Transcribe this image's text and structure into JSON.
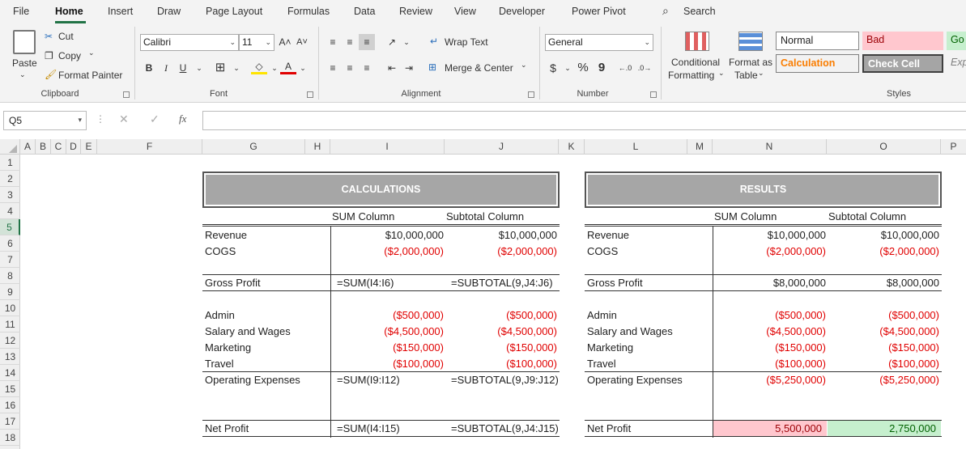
{
  "tabs": [
    "File",
    "Home",
    "Insert",
    "Draw",
    "Page Layout",
    "Formulas",
    "Data",
    "Review",
    "View",
    "Developer",
    "Power Pivot"
  ],
  "search": "Search",
  "clipboard": {
    "paste": "Paste",
    "cut": "Cut",
    "copy": "Copy",
    "format_painter": "Format Painter",
    "label": "Clipboard"
  },
  "font": {
    "name": "Calibri",
    "size": "11",
    "bold": "B",
    "italic": "I",
    "underline": "U",
    "label": "Font"
  },
  "alignment": {
    "wrap": "Wrap Text",
    "merge": "Merge & Center",
    "label": "Alignment"
  },
  "number": {
    "format": "General",
    "currency": "$",
    "percent": "%",
    "comma": "9",
    "label": "Number"
  },
  "styles": {
    "conditional": "Conditional",
    "conditional2": "Formatting",
    "format_as": "Format as",
    "format_as2": "Table",
    "normal": "Normal",
    "bad": "Bad",
    "good": "Go",
    "calculation": "Calculation",
    "check_cell": "Check Cell",
    "explanatory": "Exp",
    "label": "Styles"
  },
  "namebox": "Q5",
  "fx": "fx",
  "columns": [
    "A",
    "B",
    "C",
    "D",
    "E",
    "F",
    "G",
    "H",
    "I",
    "J",
    "K",
    "L",
    "M",
    "N",
    "O",
    "P"
  ],
  "rows": [
    "1",
    "2",
    "3",
    "4",
    "5",
    "6",
    "7",
    "8",
    "9",
    "10",
    "11",
    "12",
    "13",
    "14",
    "15",
    "16",
    "17",
    "18"
  ],
  "calc": {
    "title": "CALCULATIONS",
    "head_sum": "SUM Column",
    "head_sub": "Subtotal Column",
    "revenue": "Revenue",
    "revenue_sum": "$10,000,000",
    "revenue_sub": "$10,000,000",
    "cogs": "COGS",
    "cogs_sum": "($2,000,000)",
    "cogs_sub": "($2,000,000)",
    "gross": "Gross Profit",
    "gross_sum": "=SUM(I4:I6)",
    "gross_sub": "=SUBTOTAL(9,J4:J6)",
    "admin": "Admin",
    "admin_sum": "($500,000)",
    "admin_sub": "($500,000)",
    "salary": "Salary and Wages",
    "salary_sum": "($4,500,000)",
    "salary_sub": "($4,500,000)",
    "marketing": "Marketing",
    "marketing_sum": "($150,000)",
    "marketing_sub": "($150,000)",
    "travel": "Travel",
    "travel_sum": "($100,000)",
    "travel_sub": "($100,000)",
    "opex": "Operating Expenses",
    "opex_sum": "=SUM(I9:I12)",
    "opex_sub": "=SUBTOTAL(9,J9:J12)",
    "net": "Net Profit",
    "net_sum": "=SUM(I4:I15)",
    "net_sub": "=SUBTOTAL(9,J4:J15)"
  },
  "results": {
    "title": "RESULTS",
    "head_sum": "SUM Column",
    "head_sub": "Subtotal Column",
    "revenue": "Revenue",
    "revenue_sum": "$10,000,000",
    "revenue_sub": "$10,000,000",
    "cogs": "COGS",
    "cogs_sum": "($2,000,000)",
    "cogs_sub": "($2,000,000)",
    "gross": "Gross Profit",
    "gross_sum": "$8,000,000",
    "gross_sub": "$8,000,000",
    "admin": "Admin",
    "admin_sum": "($500,000)",
    "admin_sub": "($500,000)",
    "salary": "Salary and Wages",
    "salary_sum": "($4,500,000)",
    "salary_sub": "($4,500,000)",
    "marketing": "Marketing",
    "marketing_sum": "($150,000)",
    "marketing_sub": "($150,000)",
    "travel": "Travel",
    "travel_sum": "($100,000)",
    "travel_sub": "($100,000)",
    "opex": "Operating Expenses",
    "opex_sum": "($5,250,000)",
    "opex_sub": "($5,250,000)",
    "net": "Net Profit",
    "net_sum": "5,500,000",
    "net_sub": "2,750,000"
  },
  "colors": {
    "accent": "#217346",
    "bad_fill": "#ffc7ce",
    "good_fill": "#c6efce",
    "negative": "#e00000",
    "banner": "#a6a6a6"
  }
}
